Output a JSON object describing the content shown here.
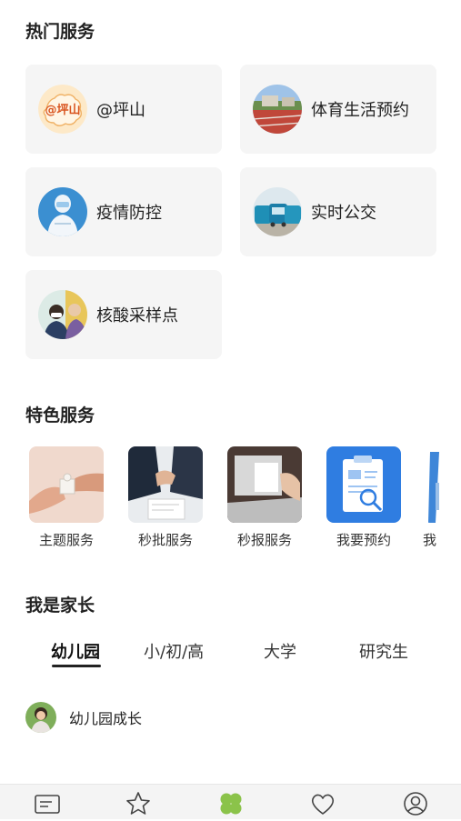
{
  "sections": {
    "hot_title": "热门服务",
    "feature_title": "特色服务",
    "parent_title": "我是家长"
  },
  "hot_services": [
    {
      "label": "@坪山",
      "icon": "pingshan-logo-icon"
    },
    {
      "label": "体育生活预约",
      "icon": "sports-field-icon"
    },
    {
      "label": "疫情防控",
      "icon": "medical-worker-icon"
    },
    {
      "label": "实时公交",
      "icon": "bus-icon"
    },
    {
      "label": "核酸采样点",
      "icon": "nucleic-test-icon"
    }
  ],
  "pingshan_logo_text": "@坪山",
  "feature_services": [
    {
      "label": "主题服务",
      "icon": "puzzle-hands-icon"
    },
    {
      "label": "秒批服务",
      "icon": "handshake-document-icon"
    },
    {
      "label": "秒报服务",
      "icon": "laptop-report-icon"
    },
    {
      "label": "我要预约",
      "icon": "clipboard-appointment-icon"
    },
    {
      "label": "我",
      "icon": "partial-service-icon"
    }
  ],
  "parent_tabs": [
    {
      "label": "幼儿园",
      "active": true
    },
    {
      "label": "小/初/高",
      "active": false
    },
    {
      "label": "大学",
      "active": false
    },
    {
      "label": "研究生",
      "active": false
    }
  ],
  "parent_list": [
    {
      "label": "幼儿园成长",
      "icon": "child-avatar-icon"
    }
  ],
  "bottom_nav": [
    {
      "name": "news-icon",
      "active": false
    },
    {
      "name": "star-icon",
      "active": false
    },
    {
      "name": "clover-icon",
      "active": true
    },
    {
      "name": "heart-icon",
      "active": false
    },
    {
      "name": "profile-icon",
      "active": false
    }
  ],
  "colors": {
    "accent_green": "#8bc34a",
    "card_bg": "#f5f5f5",
    "appointment_blue": "#2f7de1"
  }
}
